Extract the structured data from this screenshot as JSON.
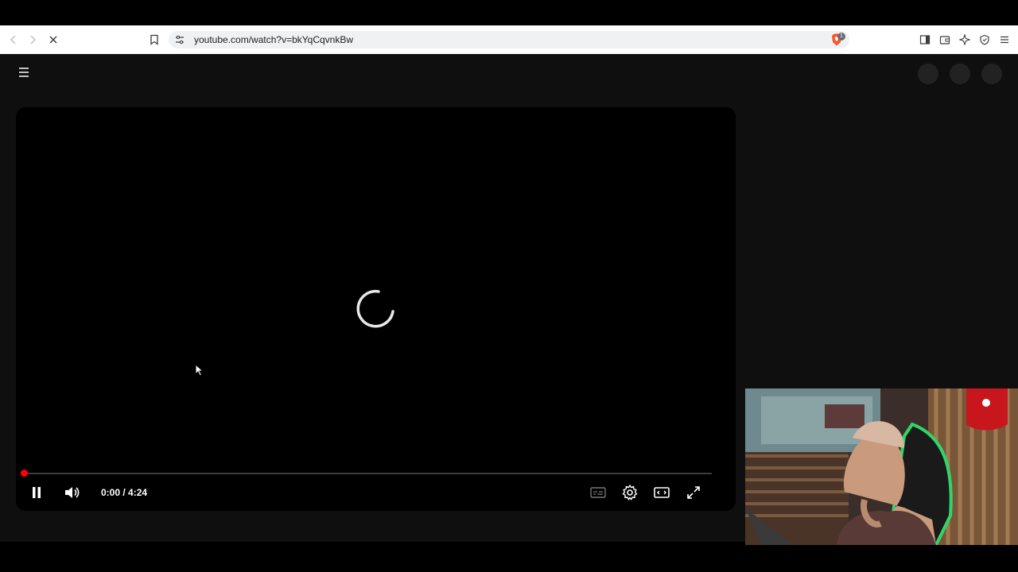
{
  "browser": {
    "url": "youtube.com/watch?v=bkYqCqvnkBw",
    "shield_badge": "1"
  },
  "player": {
    "current_time": "0:00",
    "separator": " / ",
    "duration": "4:24",
    "progress_fraction": 0.0
  },
  "colors": {
    "accent_red": "#ff0000",
    "page_bg": "#0f0f0f"
  }
}
